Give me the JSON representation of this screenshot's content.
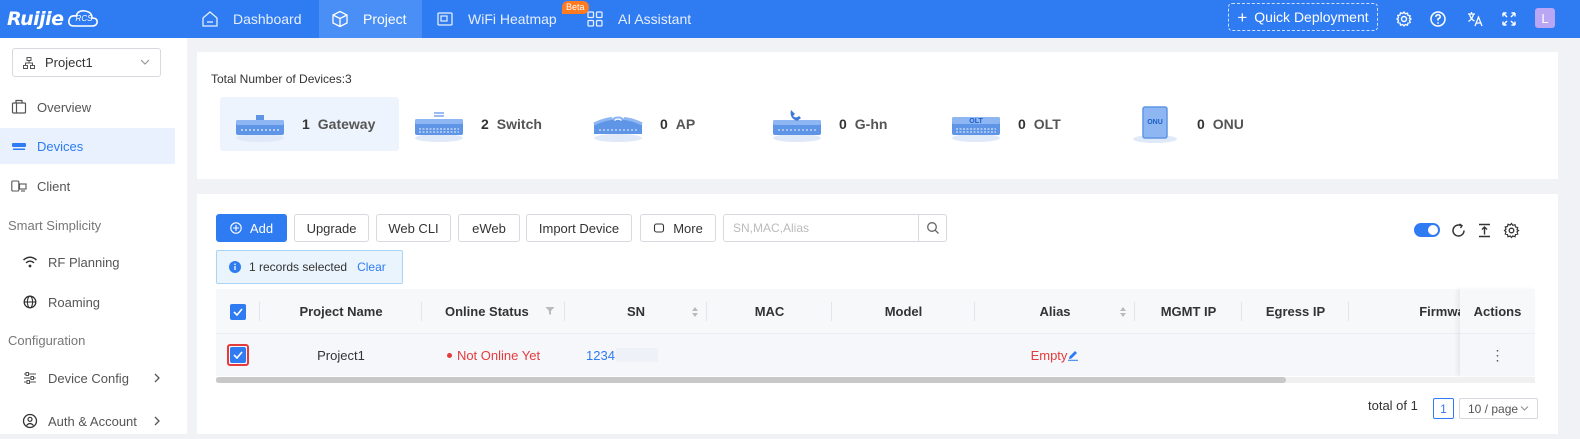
{
  "brand": {
    "logo_text": "Ruijie",
    "logo_badge": "RCS"
  },
  "nav": {
    "items": [
      {
        "label": "Dashboard",
        "icon": "home-icon"
      },
      {
        "label": "Project",
        "icon": "cube-icon",
        "active": true
      },
      {
        "label": "WiFi Heatmap",
        "icon": "heatmap-icon"
      },
      {
        "label": "AI Assistant",
        "icon": "grid-icon"
      }
    ],
    "beta_badge": "Beta",
    "quick_deployment": "Quick Deployment",
    "avatar_letter": "L"
  },
  "sidebar": {
    "project_select": "Project1",
    "items": [
      {
        "label": "Overview",
        "icon": "overview-icon"
      },
      {
        "label": "Devices",
        "icon": "devices-icon",
        "active": true
      },
      {
        "label": "Client",
        "icon": "client-icon"
      }
    ],
    "section_smart": "Smart Simplicity",
    "smart_items": [
      {
        "label": "RF Planning",
        "icon": "wifi-icon"
      },
      {
        "label": "Roaming",
        "icon": "globe-icon"
      }
    ],
    "section_config": "Configuration",
    "config_items": [
      {
        "label": "Device Config",
        "icon": "sliders-icon"
      },
      {
        "label": "Auth & Account",
        "icon": "user-circle-icon"
      }
    ]
  },
  "summary": {
    "total_label": "Total Number of Devices:3",
    "devices": [
      {
        "count": "1",
        "name": "Gateway",
        "active": true
      },
      {
        "count": "2",
        "name": "Switch"
      },
      {
        "count": "0",
        "name": "AP"
      },
      {
        "count": "0",
        "name": "G-hn"
      },
      {
        "count": "0",
        "name": "OLT",
        "device_text": "OLT"
      },
      {
        "count": "0",
        "name": "ONU",
        "device_text": "ONU"
      }
    ]
  },
  "toolbar": {
    "add": "Add",
    "upgrade": "Upgrade",
    "web_cli": "Web CLI",
    "eweb": "eWeb",
    "import_device": "Import Device",
    "more": "More",
    "search_placeholder": "SN,MAC,Alias"
  },
  "selection": {
    "text": "1 records selected",
    "clear": "Clear"
  },
  "table": {
    "columns": [
      "Project Name",
      "Online Status",
      "SN",
      "MAC",
      "Model",
      "Alias",
      "MGMT IP",
      "Egress IP",
      "Firmware",
      "Actions"
    ],
    "rows": [
      {
        "project_name": "Project1",
        "online_status": "Not Online Yet",
        "sn": "1234",
        "mac": "",
        "model": "",
        "alias": "Empty",
        "mgmt_ip": "",
        "egress_ip": "",
        "firmware": "",
        "actions": "⋮"
      }
    ]
  },
  "pagination": {
    "total": "total of 1",
    "current_page": "1",
    "page_size": "10 / page"
  },
  "colors": {
    "primary": "#2f7bf2",
    "danger": "#e43c3c",
    "beta": "#ff7a20"
  }
}
